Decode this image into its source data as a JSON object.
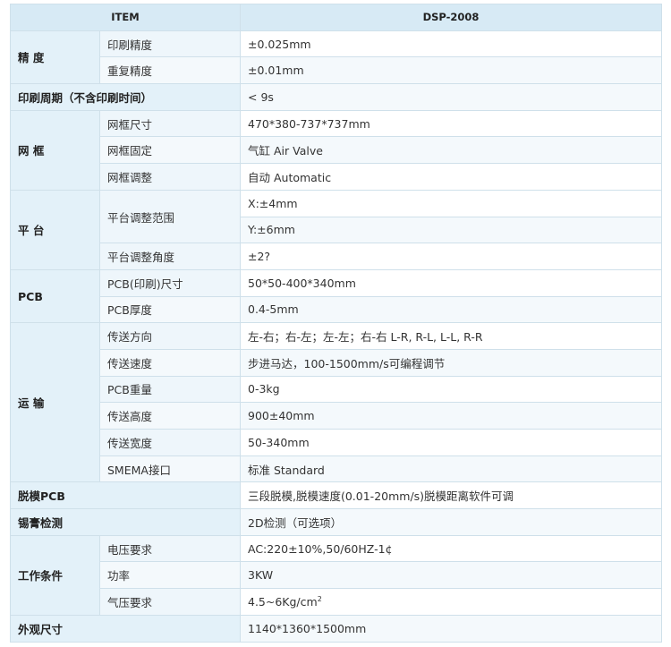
{
  "header": {
    "item": "ITEM",
    "model": "DSP-2008"
  },
  "rows": {
    "precision": {
      "category": "精 度",
      "print_label": "印刷精度",
      "print_value": "±0.025mm",
      "repeat_label": "重复精度",
      "repeat_value": "±0.01mm"
    },
    "cycle": {
      "label": "印刷周期（不含印刷时间）",
      "value": "< 9s"
    },
    "stencil": {
      "category": "网 框",
      "size_label": "网框尺寸",
      "size_value": "470*380-737*737mm",
      "fix_label": "网框固定",
      "fix_value": "气缸 Air Valve",
      "adjust_label": "网框调整",
      "adjust_value": "自动 Automatic"
    },
    "platform": {
      "category": "平 台",
      "range_label": "平台调整范围",
      "range_x": "X:±4mm",
      "range_y": "Y:±6mm",
      "angle_label": "平台调整角度",
      "angle_value": "±2?"
    },
    "pcb": {
      "category": "PCB",
      "size_label": "PCB(印刷)尺寸",
      "size_value": "50*50-400*340mm",
      "thickness_label": "PCB厚度",
      "thickness_value": "0.4-5mm"
    },
    "transport": {
      "category": "运 输",
      "direction_label": "传送方向",
      "direction_value": "左-右；右-左；左-左；右-右 L-R, R-L, L-L, R-R",
      "speed_label": "传送速度",
      "speed_value": "步进马达，100-1500mm/s可编程调节",
      "weight_label": "PCB重量",
      "weight_value": "0-3kg",
      "height_label": "传送高度",
      "height_value": "900±40mm",
      "width_label": "传送宽度",
      "width_value": "50-340mm",
      "smema_label": "SMEMA接口",
      "smema_value": "标准 Standard"
    },
    "demold": {
      "label": "脱模PCB",
      "value": "三段脱模,脱模速度(0.01-20mm/s)脱模距离软件可调"
    },
    "solder": {
      "label": "锡膏检测",
      "value": "2D检测（可选项）"
    },
    "working": {
      "category": "工作条件",
      "voltage_label": "电压要求",
      "voltage_value": "AC:220±10%,50/60HZ-1¢",
      "power_label": "功率",
      "power_value": "3KW",
      "air_label": "气压要求",
      "air_value_base": "4.5~6Kg/cm",
      "air_value_sup": "2"
    },
    "dimension": {
      "label": "外观尺寸",
      "value": "1140*1360*1500mm"
    }
  },
  "colors": {
    "border": "#cfe0ea",
    "header_bg": "#d7eaf5",
    "category_bg": "#e3f1f9",
    "sub_bg": "#eef6fb"
  }
}
